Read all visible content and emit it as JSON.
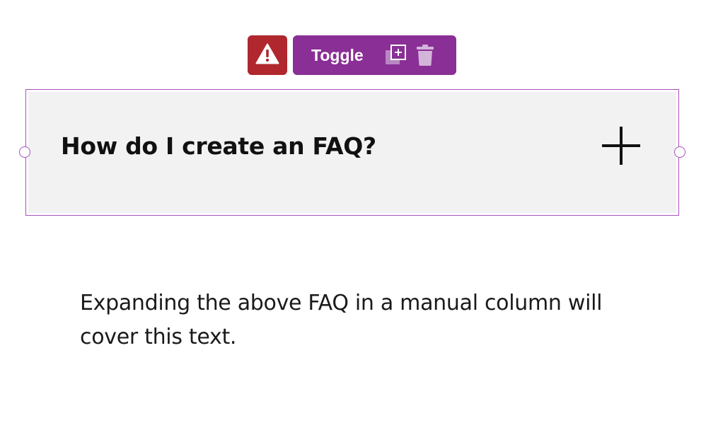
{
  "toolbar": {
    "block_label": "Toggle",
    "warning_color": "#b0272e",
    "accent_color": "#8a2f96",
    "icons": [
      "warning-icon",
      "duplicate-icon",
      "trash-icon"
    ]
  },
  "faq": {
    "question": "How do I create an FAQ?",
    "expand_icon": "plus-icon",
    "header_background": "#f2f2f3",
    "selection_color": "#a94fbf"
  },
  "content": {
    "paragraph": "Expanding the above FAQ in a manual column will cover this text."
  }
}
